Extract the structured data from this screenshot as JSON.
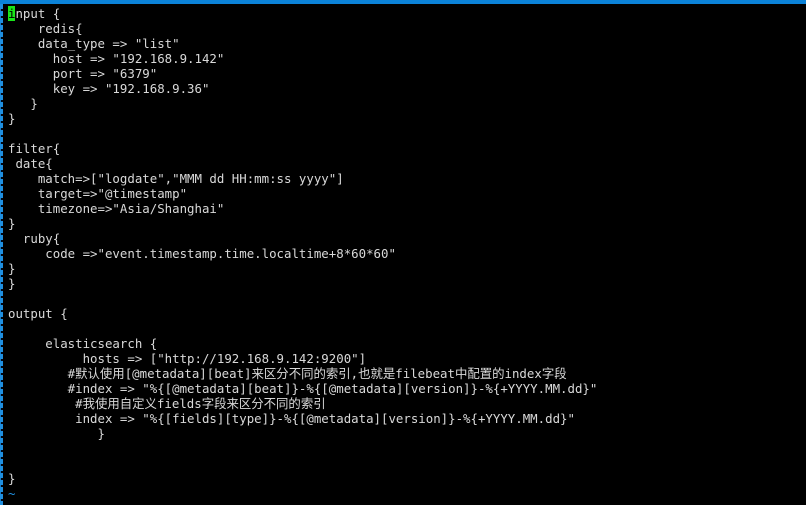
{
  "window": {
    "title": "logstash-config-editor",
    "top_bar_color": "#0b83d9",
    "background_color": "#000000",
    "text_color": "#d9d9d9",
    "cursor_color": "#19e619",
    "cursor_char": "i",
    "tilde_color": "#1f8fe0"
  },
  "editor": {
    "filler_char": "~",
    "lines": [
      "input {",
      "    redis{",
      "    data_type => \"list\"",
      "      host => \"192.168.9.142\"",
      "      port => \"6379\"",
      "      key => \"192.168.9.36\"",
      "   }",
      "}",
      "",
      "filter{",
      " date{",
      "    match=>[\"logdate\",\"MMM dd HH:mm:ss yyyy\"]",
      "    target=>\"@timestamp\"",
      "    timezone=>\"Asia/Shanghai\"",
      "}",
      "  ruby{",
      "     code =>\"event.timestamp.time.localtime+8*60*60\"",
      "}",
      "}",
      "",
      "output {",
      "",
      "     elasticsearch {",
      "          hosts => [\"http://192.168.9.142:9200\"]",
      "        #默认使用[@metadata][beat]来区分不同的索引,也就是filebeat中配置的index字段",
      "        #index => \"%{[@metadata][beat]}-%{[@metadata][version]}-%{+YYYY.MM.dd}\"",
      "         #我使用自定义fields字段来区分不同的索引",
      "         index => \"%{[fields][type]}-%{[@metadata][version]}-%{+YYYY.MM.dd}\"",
      "            }",
      "",
      "",
      "}",
      "~"
    ]
  }
}
